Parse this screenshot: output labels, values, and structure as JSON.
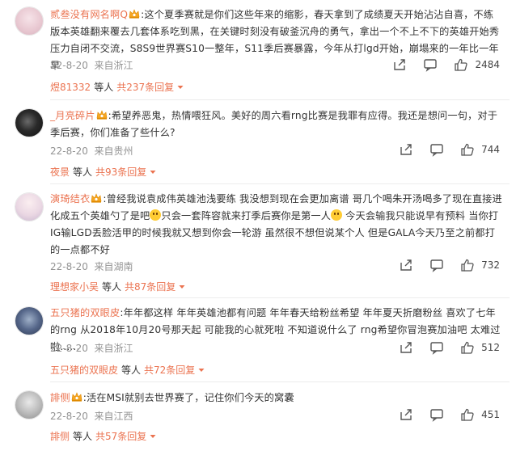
{
  "colors": {
    "username": "#eb7350",
    "meta": "#939393",
    "text": "#333333"
  },
  "comments": [
    {
      "user": "贰叁没有网名啊Q",
      "text": "这个夏季赛就是你们这些年来的缩影，春天拿到了成绩夏天开始沾沾自喜，不练版本英雄翻来覆去几套体系吃到黑，在关键时刻没有破釜沉舟的勇气，拿出一个不上不下的英雄开始秀压力自闭不交流，S8S9世界赛S10一整年，S11季后赛暴露，今年从打lgd开始，崩塌来的一年比一年早",
      "date": "22-8-20",
      "location": "来自浙江",
      "likes": "2484",
      "reply_user": "煜81332",
      "reply_mid": "等人",
      "reply_link": "共237条回复"
    },
    {
      "user": "_月亮碎片",
      "text": "希望养恶鬼，热情喂狂风。美好的周六看rng比赛是我罪有应得。我还是想问一句，对于季后赛，你们准备了些什么?",
      "date": "22-8-20",
      "location": "来自贵州",
      "likes": "744",
      "reply_user": "夜景",
      "reply_mid": "等人",
      "reply_link": "共93条回复"
    },
    {
      "user": "演琦结衣",
      "text_a": "曾经我说袁成伟英雄池浅要练  我没想到现在会更加离谱  哥几个喝朱开汤喝多了现在直接进化成五个英雄勺了是吧",
      "text_b": "只会一套阵容就来打季后赛你是第一人",
      "text_c": " 今天会输我只能说早有预料  当你打IG输LGD丢脸活甲的时候我就又想到你会一轮游  虽然很不想但说某个人 但是GALA今天乃至之前都打的一点都不好",
      "date": "22-8-20",
      "location": "来自湖南",
      "likes": "732",
      "reply_user": "理想家小吴",
      "reply_mid": "等人",
      "reply_link": "共87条回复"
    },
    {
      "user": "五只猪的双眼皮",
      "text": "年年都这样  年年英雄池都有问题  年年春天给粉丝希望  年年夏天折磨粉丝  喜欢了七年的rng  从2018年10月20号那天起  可能我的心就死啦  不知道说什么了  rng希望你冒泡赛加油吧  太难过啦......",
      "date": "22-8-20",
      "location": "来自浙江",
      "likes": "512",
      "reply_user": "五只猪的双眼皮",
      "reply_mid": "等人",
      "reply_link": "共72条回复"
    },
    {
      "user": "誹侧",
      "text": "活在MSI就别去世界赛了，记住你们今天的窝囊",
      "date": "22-8-20",
      "location": "来自江西",
      "likes": "451",
      "reply_user": "誹侧",
      "reply_mid": "等人",
      "reply_link": "共57条回复"
    }
  ]
}
